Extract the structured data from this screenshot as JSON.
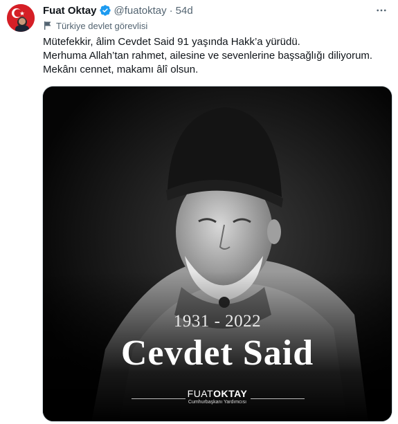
{
  "tweet": {
    "author_name": "Fuat Oktay",
    "handle": "@fuatoktay",
    "separator": "·",
    "time": "54d",
    "label": "Türkiye devlet görevlisi",
    "text_lines": [
      "Mütefekkir, âlim Cevdet Said 91 yaşında Hakk’a yürüdü.",
      "Merhuma Allah’tan rahmet, ailesine ve sevenlerine başsağlığı diliyorum.",
      "Mekânı cennet, makamı âlî olsun."
    ]
  },
  "media": {
    "years": "1931 - 2022",
    "name": "Cevdet Said",
    "signature_first": "FUAT",
    "signature_last": "OKTAY",
    "signature_sub": "Cumhurbaşkanı Yardımcısı"
  },
  "icons": {
    "verified": "verified-badge-icon",
    "more": "more-options-icon",
    "label": "flag-icon",
    "avatar_flag": "turkish-flag-icon"
  },
  "colors": {
    "verified_blue": "#1d9bf0",
    "secondary_text": "#536471",
    "avatar_red": "#d51f26"
  }
}
